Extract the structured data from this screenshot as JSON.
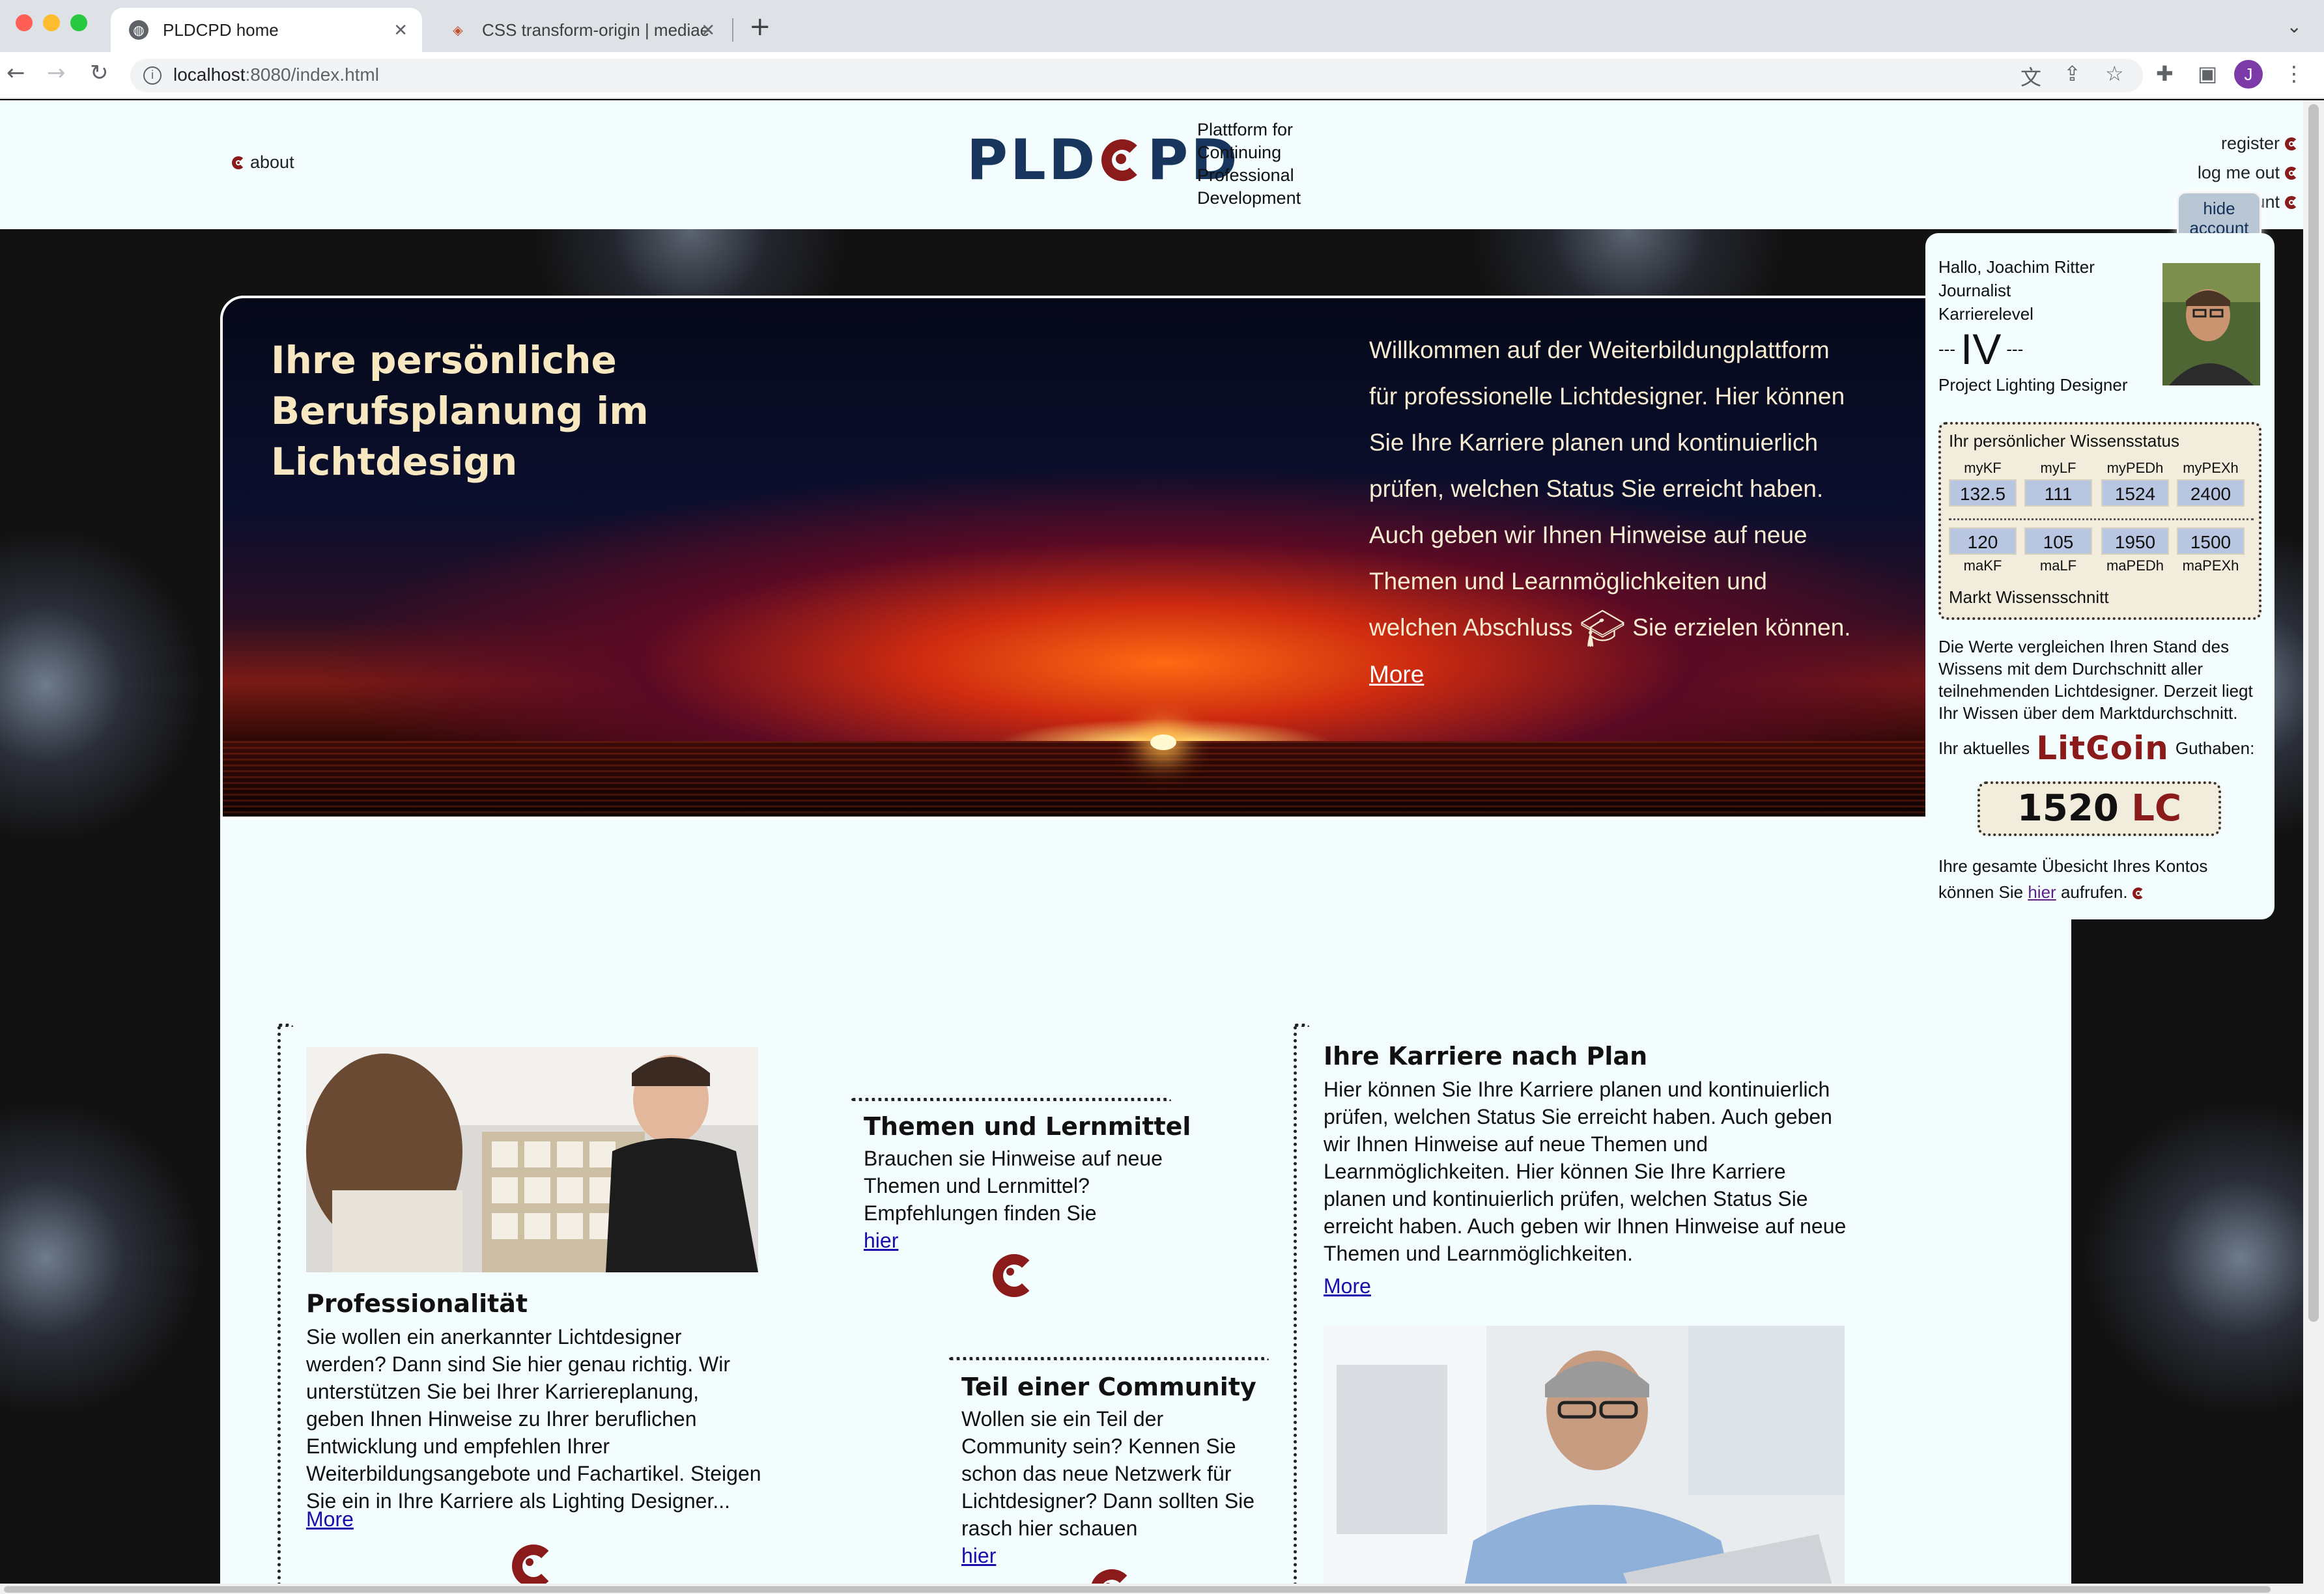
{
  "browser": {
    "tabs": [
      {
        "title": "PLDCPD home",
        "active": true
      },
      {
        "title": "CSS transform-origin | mediae",
        "active": false
      }
    ],
    "url_host": "localhost",
    "url_rest": ":8080/index.html",
    "profile_initial": "J"
  },
  "header": {
    "about": "about",
    "logo_left": "PLD",
    "logo_right": "PD",
    "tagline": [
      "Plattform for",
      "Continuing",
      "Professional",
      "Development"
    ],
    "links": [
      "register",
      "log me out",
      "account"
    ]
  },
  "hero": {
    "title": "Ihre persönliche Berufsplanung im Lichtdesign",
    "text_before_icon": "Willkommen auf der Weiterbildungplattform für professionelle Lichtdesigner. Hier können Sie Ihre Karriere planen und kontinuierlich prüfen, welchen Status Sie erreicht haben. Auch geben wir Ihnen Hinweise auf neue Themen und Learnmöglichkeiten und welchen Abschluss",
    "text_after_icon": "Sie erzielen können.",
    "more": "More"
  },
  "sections": {
    "professionalitaet": {
      "title": "Professionalität",
      "text": "Sie wollen ein anerkannter Lichtdesigner werden? Dann sind Sie hier genau richtig. Wir unterstützen Sie bei Ihrer Karriereplanung, geben Ihnen Hinweise zu Ihrer beruflichen Entwicklung und empfehlen Ihrer Weiterbildungsangebote und Fachartikel. Steigen Sie ein in Ihre Karriere als Lighting Designer...",
      "link": "More"
    },
    "themen": {
      "title": "Themen und Lernmittel",
      "text": "Brauchen sie Hinweise auf neue Themen und Lernmittel? Empfehlungen finden Sie",
      "link": "hier"
    },
    "community": {
      "title": "Teil einer Community",
      "text": "Wollen sie ein Teil der Community sein? Kennen Sie schon das neue Netzwerk für Lichtdesigner? Dann sollten Sie rasch hier schauen",
      "link": "hier"
    },
    "karriere": {
      "title": "Ihre Karriere nach Plan",
      "text": "Hier können Sie Ihre Karriere planen und kontinuierlich prüfen, welchen Status Sie erreicht haben. Auch geben wir Ihnen Hinweise auf neue Themen und Learnmöglichkeiten. Hier können Sie Ihre Karriere planen und kontinuierlich prüfen, welchen Status Sie erreicht haben. Auch geben wir Ihnen Hinweise auf neue Themen und Learnmöglichkeiten.",
      "link": "More"
    }
  },
  "account": {
    "hide_button": "hide account",
    "greeting": "Hallo, Joachim Ritter",
    "occupation": "Journalist",
    "level_label": "Karrierelevel",
    "level": "IV",
    "role": "Project Lighting Designer",
    "status_title": "Ihr persönlicher Wissensstatus",
    "my_labels": [
      "myKF",
      "myLF",
      "myPEDh",
      "myPEXh"
    ],
    "my_values": [
      "132.5",
      "111",
      "1524",
      "2400"
    ],
    "ma_values": [
      "120",
      "105",
      "1950",
      "1500"
    ],
    "ma_labels": [
      "maKF",
      "maLF",
      "maPEDh",
      "maPEXh"
    ],
    "markt": "Markt Wissensschnitt",
    "description": "Die Werte vergleichen Ihren Stand des Wissens mit dem Durchschnitt aller teilnehmenden Lichtdesigner. Derzeit liegt Ihr Wissen über dem Marktdurchschnitt.",
    "balance_prefix": "Ihr aktuelles",
    "litcoin_left": "Lit",
    "litcoin_right": "oin",
    "balance_suffix": "Guthaben:",
    "balance": "1520",
    "balance_unit": "LC",
    "overview_text": "Ihre gesamte Übesicht Ihres Kontos können Sie",
    "overview_link": "hier",
    "overview_end": "aufrufen."
  }
}
